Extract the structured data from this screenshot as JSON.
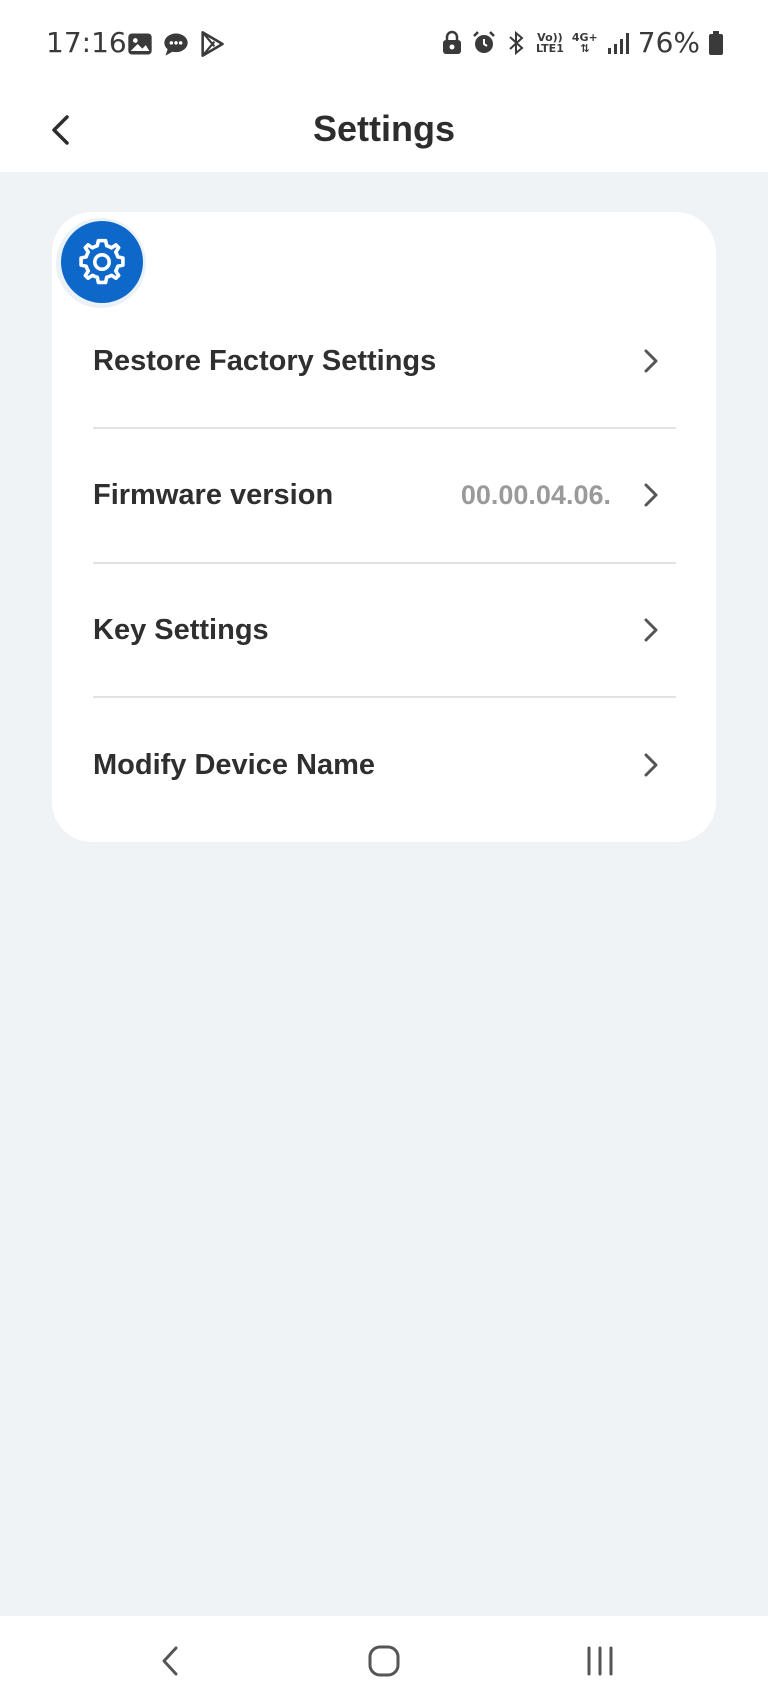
{
  "status_bar": {
    "time": "17:16",
    "left_icons": [
      "gallery-icon",
      "message-icon",
      "play-store-icon"
    ],
    "right_icons": [
      "lock-icon",
      "alarm-icon",
      "bluetooth-icon",
      "volte-icon",
      "network-4g-icon",
      "signal-icon",
      "battery-icon"
    ],
    "volte_label_top": "Vo))",
    "volte_label_bottom": "LTE1",
    "network_label": "4G+",
    "battery": "76%"
  },
  "header": {
    "title": "Settings",
    "back_icon": "chevron-left-icon"
  },
  "card": {
    "badge_icon": "gear-icon",
    "items": [
      {
        "label": "Restore Factory Settings",
        "value": "",
        "icon": "chevron-right-icon"
      },
      {
        "label": "Firmware version",
        "value": "00.00.04.06.",
        "icon": "chevron-right-icon"
      },
      {
        "label": "Key Settings",
        "value": "",
        "icon": "chevron-right-icon"
      },
      {
        "label": "Modify Device Name",
        "value": "",
        "icon": "chevron-right-icon"
      }
    ]
  },
  "nav_bar": {
    "icons": [
      "nav-back-icon",
      "nav-home-icon",
      "nav-recents-icon"
    ]
  },
  "colors": {
    "accent": "#0d68c9",
    "background": "#f0f3f5",
    "card": "#ffffff",
    "text": "#2f2f2f",
    "muted_text": "#9a9a9a"
  }
}
